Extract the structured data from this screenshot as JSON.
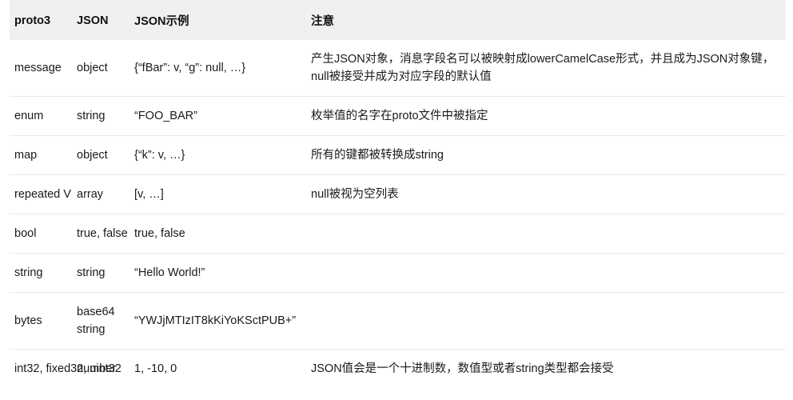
{
  "table": {
    "name": "proto3-json-mapping-table",
    "header_background": "#f0f0f0",
    "row_divider_color": "#e9e9e9",
    "columns": [
      {
        "key": "proto3",
        "label": "proto3"
      },
      {
        "key": "json",
        "label": "JSON"
      },
      {
        "key": "example",
        "label": "JSON示例"
      },
      {
        "key": "notes",
        "label": "注意"
      }
    ],
    "rows": [
      {
        "proto3": "message",
        "json": "object",
        "example": "{“fBar”: v, “g”: null, …}",
        "notes": "产生JSON对象，消息字段名可以被映射成lowerCamelCase形式，并且成为JSON对象键，null被接受并成为对应字段的默认值"
      },
      {
        "proto3": "enum",
        "json": "string",
        "example": "“FOO_BAR”",
        "notes": "枚举值的名字在proto文件中被指定"
      },
      {
        "proto3": "map",
        "json": "object",
        "example": "{“k”: v, …}",
        "notes": "所有的键都被转换成string"
      },
      {
        "proto3": "repeated V",
        "json": "array",
        "example": "[v, …]",
        "notes": "null被视为空列表"
      },
      {
        "proto3": "bool",
        "json": "true, false",
        "example": "true, false",
        "notes": ""
      },
      {
        "proto3": "string",
        "json": "string",
        "example": "“Hello World!”",
        "notes": ""
      },
      {
        "proto3": "bytes",
        "json": "base64 string",
        "example": "“YWJjMTIzIT8kKiYoKSctPUB+”",
        "notes": ""
      },
      {
        "proto3": "int32,\nfixed32,\nuint32",
        "json": "number",
        "example": "1, -10, 0",
        "notes": "JSON值会是一个十进制数，数值型或者string类型都会接受"
      }
    ]
  }
}
